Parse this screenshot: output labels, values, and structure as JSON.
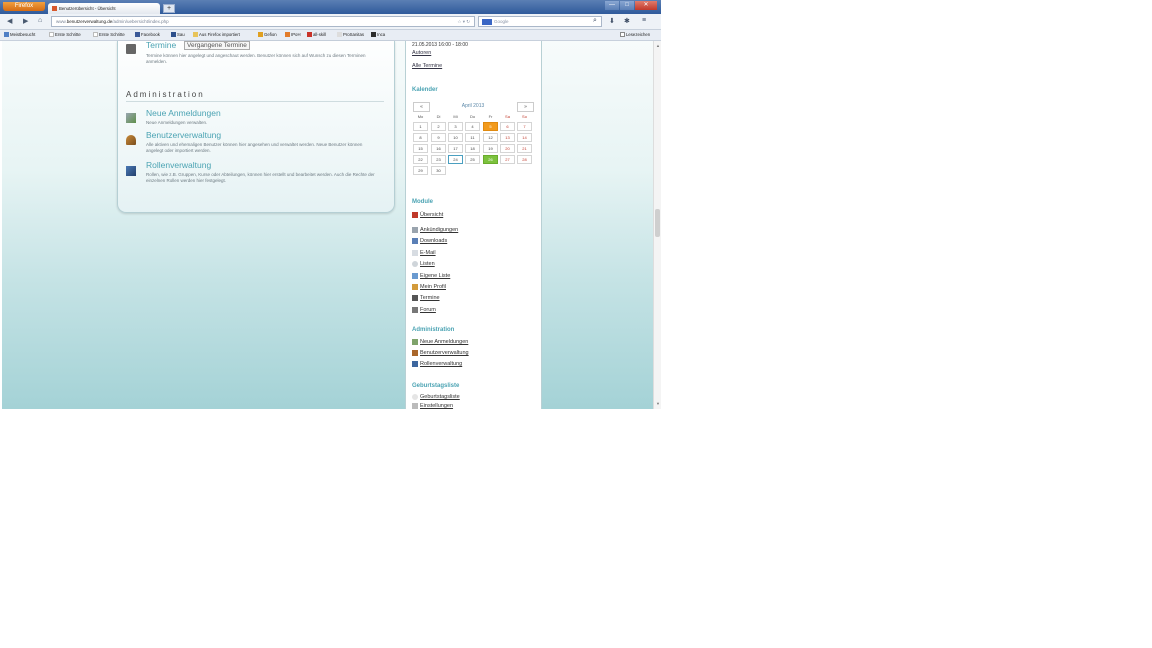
{
  "browser": {
    "menu_button_label": "Firefox",
    "tab_title": "Benutzerübersicht - Übersicht",
    "new_tab_label": "+",
    "window_buttons": [
      "—",
      "□",
      "✕"
    ],
    "url_prefix": "www.",
    "url_domain": "benutzerverwaltung.de",
    "url_path": "/admin/uebersicht/index.php",
    "search_placeholder": "Google",
    "bookmarks": [
      "Meistbesucht",
      "Erste Schritte",
      "Erste Schritte",
      "Facebook",
      "Sau",
      "Aus Firefox importiert",
      "Gefion",
      "IPoH",
      "all-skill",
      "ProSanitas",
      "Inca"
    ],
    "bookmarks_right": "Lesezeichen"
  },
  "main": {
    "termine": {
      "title": "Termine",
      "button": "Vergangene Termine",
      "desc": "Termine können hier angelegt und angeschaut werden. Benutzer können sich auf Wunsch zu diesen Terminen anmelden."
    },
    "admin_heading": "Administration",
    "modules": [
      {
        "title": "Neue Anmeldungen",
        "desc": "Neue Anmeldungen verwalten."
      },
      {
        "title": "Benutzerverwaltung",
        "desc": "Alle aktiven und ehemaligen Benutzer können hier angesehen und verwaltet werden. Neue Benutzer können angelegt oder importiert werden."
      },
      {
        "title": "Rollenverwaltung",
        "desc": "Rollen, wie z.B. Gruppen, Kurse oder Abteilungen, können hier erstellt und bearbeitet werden. Auch die Rechte der einzelnen Rollen werden hier festgelegt."
      }
    ]
  },
  "sidebar": {
    "event_date": "21.05.2013 16:00 - 18:00",
    "event_link": "Autoren",
    "all_events_link": "Alle Termine",
    "calendar": {
      "heading": "Kalender",
      "prev": "«",
      "next": "»",
      "title": "April 2013",
      "weekdays": [
        "Mo",
        "Di",
        "Mi",
        "Do",
        "Fr",
        "Sa",
        "So"
      ],
      "days": [
        [
          "1",
          "2",
          "3",
          "4",
          "5",
          "6",
          "7"
        ],
        [
          "8",
          "9",
          "10",
          "11",
          "12",
          "13",
          "14"
        ],
        [
          "15",
          "16",
          "17",
          "18",
          "19",
          "20",
          "21"
        ],
        [
          "22",
          "23",
          "24",
          "25",
          "26",
          "27",
          "28"
        ],
        [
          "29",
          "30",
          "",
          "",
          "",
          "",
          ""
        ]
      ]
    },
    "modules_heading": "Module",
    "overview_link": "Übersicht",
    "module_links": [
      "Ankündigungen",
      "Downloads",
      "E-Mail",
      "Listen",
      "Eigene Liste",
      "Mein Profil",
      "Termine",
      "Forum"
    ],
    "admin_heading": "Administration",
    "admin_links": [
      "Neue Anmeldungen",
      "Benutzerverwaltung",
      "Rollenverwaltung"
    ],
    "birthday_heading": "Geburtstagsliste",
    "birthday_links": [
      "Geburtstagsliste",
      "Einstellungen"
    ]
  },
  "colors": {
    "accent": "#4ba3b3",
    "highlight_orange": "#f29a1c",
    "highlight_green": "#7cc23d"
  }
}
